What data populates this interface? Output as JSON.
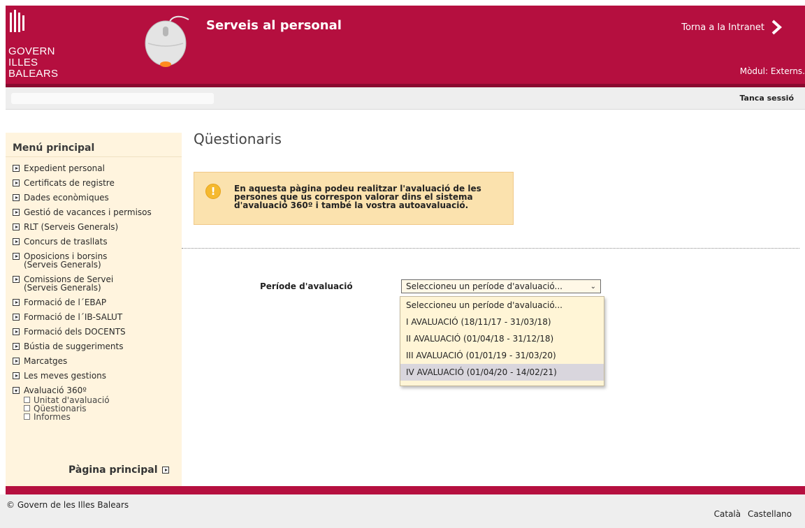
{
  "header": {
    "logo_lines": [
      "GOVERN",
      "ILLES",
      "BALEARS"
    ],
    "app_title": "Serveis al personal",
    "back_link": "Torna a la Intranet",
    "module": "Mòdul: Externs.",
    "brand_color": "#b50f3f"
  },
  "session": {
    "logout": "Tanca sessió"
  },
  "sidebar": {
    "title": "Menú principal",
    "items": [
      "Expedient personal",
      "Certificats de registre",
      "Dades econòmiques",
      "Gestió de vacances i permisos",
      "RLT (Serveis Generals)",
      "Concurs de trasllats",
      "Oposicions i borsins (Serveis Generals)",
      "Comissions de Servei (Serveis Generals)",
      "Formació de l´EBAP",
      "Formació de l´IB-SALUT",
      "Formació dels DOCENTS",
      "Bústia de suggeriments",
      "Marcatges",
      "Les meves gestions"
    ],
    "expanded": {
      "label": "Avaluació 360º",
      "subitems": [
        "Unitat d'avaluació",
        "Qüestionaris",
        "Informes"
      ]
    },
    "home_link": "Pàgina principal"
  },
  "main": {
    "title": "Qüestionaris",
    "info": "En aquesta pàgina podeu realitzar l'avaluació de les persones que us correspon valorar dins el sistema d'avaluació 360º i també la vostra autoavaluació.",
    "field_label": "Període d'avaluació",
    "select_value": "Seleccioneu un període d'avaluació...",
    "options": [
      "Seleccioneu un període d'avaluació...",
      "I AVALUACIÓ (18/11/17 - 31/03/18)",
      "II AVALUACIÓ (01/04/18 - 31/12/18)",
      "III AVALUACIÓ (01/01/19 - 31/03/20)",
      "IV AVALUACIÓ (01/04/20 - 14/02/21)"
    ],
    "highlighted_option": "IV AVALUACIÓ (01/04/20 - 14/02/21)"
  },
  "footer": {
    "copyright": "© Govern de les Illes Balears",
    "languages": [
      "Català",
      "Castellano"
    ]
  }
}
